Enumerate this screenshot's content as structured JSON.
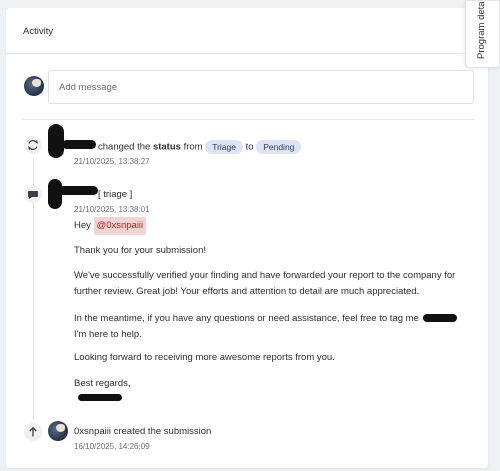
{
  "panel": {
    "title": "Activity",
    "side_tab_label": "Program details"
  },
  "composer": {
    "placeholder": "Add message"
  },
  "events": {
    "status_change": {
      "text_before": "changed the",
      "field": "status",
      "from_word": "from",
      "from_value": "Triage",
      "to_word": "to",
      "to_value": "Pending",
      "timestamp": "21/10/2025, 13:38:27",
      "icon": "refresh-icon"
    },
    "comment": {
      "tag": "[ triage ]",
      "timestamp": "21/10/2025, 13:38:01",
      "icon": "comment-icon",
      "greeting": "Hey",
      "mention": "@0xsnpaiii",
      "p1": "Thank you for your submission!",
      "p2": "We've successfully verified your finding and have forwarded your report to the company for further review. Great job! Your efforts and attention to detail are much appreciated.",
      "p3_before": "In the meantime, if you have any questions or need assistance, feel free to tag me",
      "p3_after": "I'm here to help.",
      "p4": "Looking forward to receiving more awesome reports from you.",
      "p5": "Best regards,"
    },
    "created": {
      "user": "0xsnpaiii",
      "text": "created the submission",
      "timestamp": "16/10/2025, 14:26:09",
      "icon": "arrow-up-icon"
    }
  },
  "colors": {
    "pill_bg": "#dde3f2",
    "mention_bg": "#f6d3d3",
    "mention_text": "#b02a2a"
  }
}
